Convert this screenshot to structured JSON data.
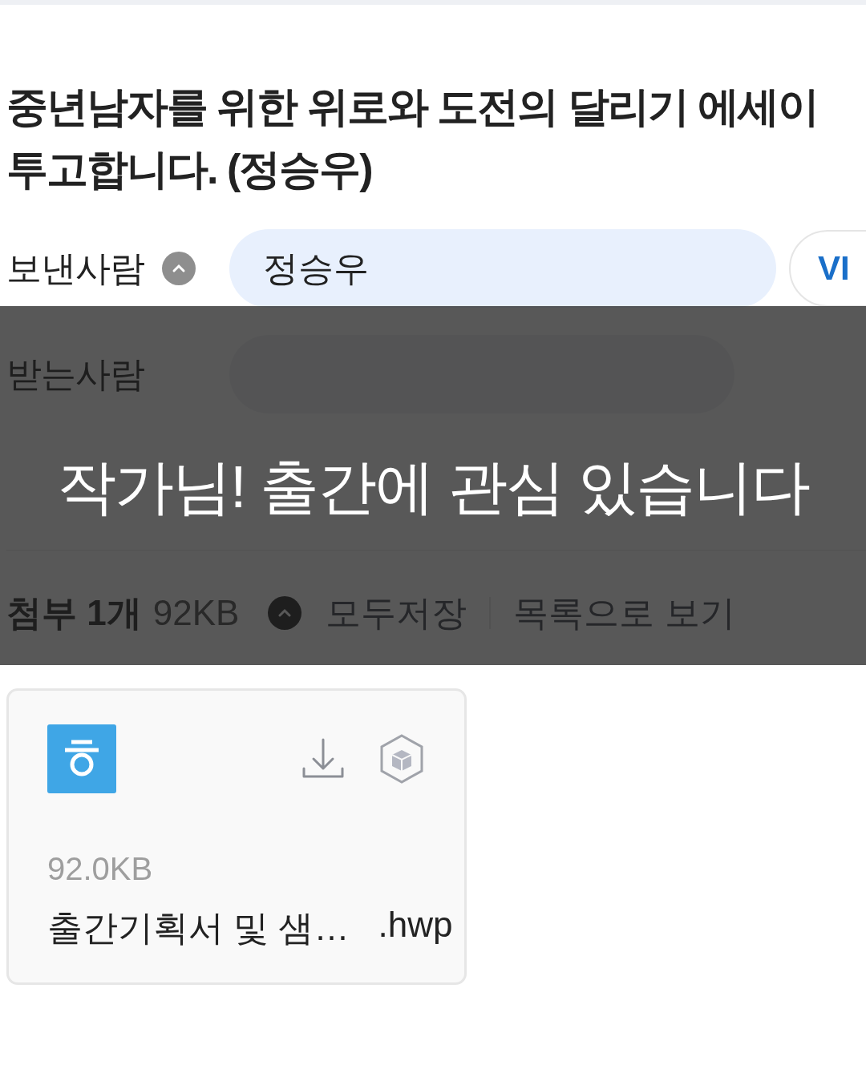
{
  "subject": "중년남자를 위한 위로와 도전의 달리기 에세이 투고합니다. (정승우)",
  "sender": {
    "label": "보낸사람",
    "name": "정승우",
    "badge": "VI"
  },
  "recipient": {
    "label": "받는사람"
  },
  "attachments": {
    "summary": "첨부 1개",
    "size": "92KB",
    "save_all": "모두저장",
    "list_view": "목록으로 보기",
    "files": [
      {
        "size": "92.0KB",
        "name": "출간기획서 및 샘…",
        "extension": ".hwp"
      }
    ]
  },
  "overlay": {
    "text": "작가님! 출간에 관심 있습니다"
  }
}
